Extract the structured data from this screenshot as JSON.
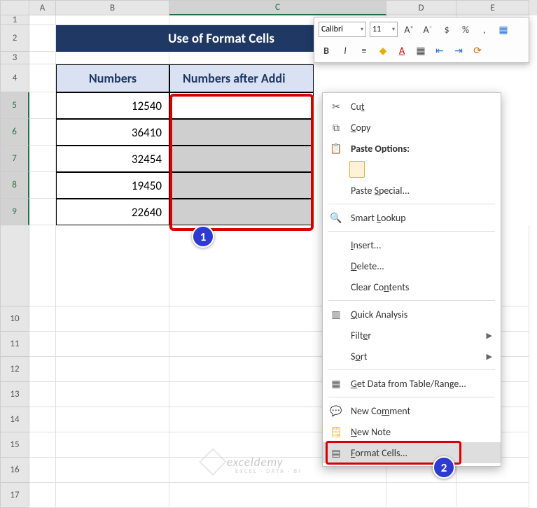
{
  "columns": [
    "A",
    "B",
    "C",
    "D",
    "E"
  ],
  "rows_top": [
    "1",
    "2",
    "3",
    "4",
    "5",
    "6",
    "7",
    "8",
    "9"
  ],
  "rows_bottom": [
    "10",
    "11",
    "12",
    "13",
    "14",
    "15",
    "16",
    "17"
  ],
  "title": "Use of Format Cells",
  "table": {
    "header_b": "Numbers",
    "header_c": "Numbers after Addi",
    "values": [
      "12540",
      "36410",
      "32454",
      "19450",
      "22640"
    ]
  },
  "mini_toolbar": {
    "font_name": "Calibri",
    "font_size": "11",
    "icons_row1": [
      "A⁺",
      "A⁻",
      "$",
      "%",
      ",",
      "▦"
    ],
    "icons_row2": [
      "B",
      "I",
      "≡",
      "◆",
      "A",
      "▦",
      "⇤",
      "⇥",
      "⟳"
    ]
  },
  "context_menu": {
    "cut": "Cut",
    "copy": "Copy",
    "paste_options": "Paste Options:",
    "paste_special": "Paste Special...",
    "smart_lookup": "Smart Lookup",
    "insert": "Insert...",
    "delete": "Delete...",
    "clear_contents": "Clear Contents",
    "quick_analysis": "Quick Analysis",
    "filter": "Filter",
    "sort": "Sort",
    "get_data": "Get Data from Table/Range...",
    "new_comment": "New Comment",
    "new_note": "New Note",
    "format_cells": "Format Cells..."
  },
  "badges": {
    "one": "1",
    "two": "2"
  },
  "watermark": {
    "main": "exceldemy",
    "sub": "EXCEL · DATA · BI"
  }
}
